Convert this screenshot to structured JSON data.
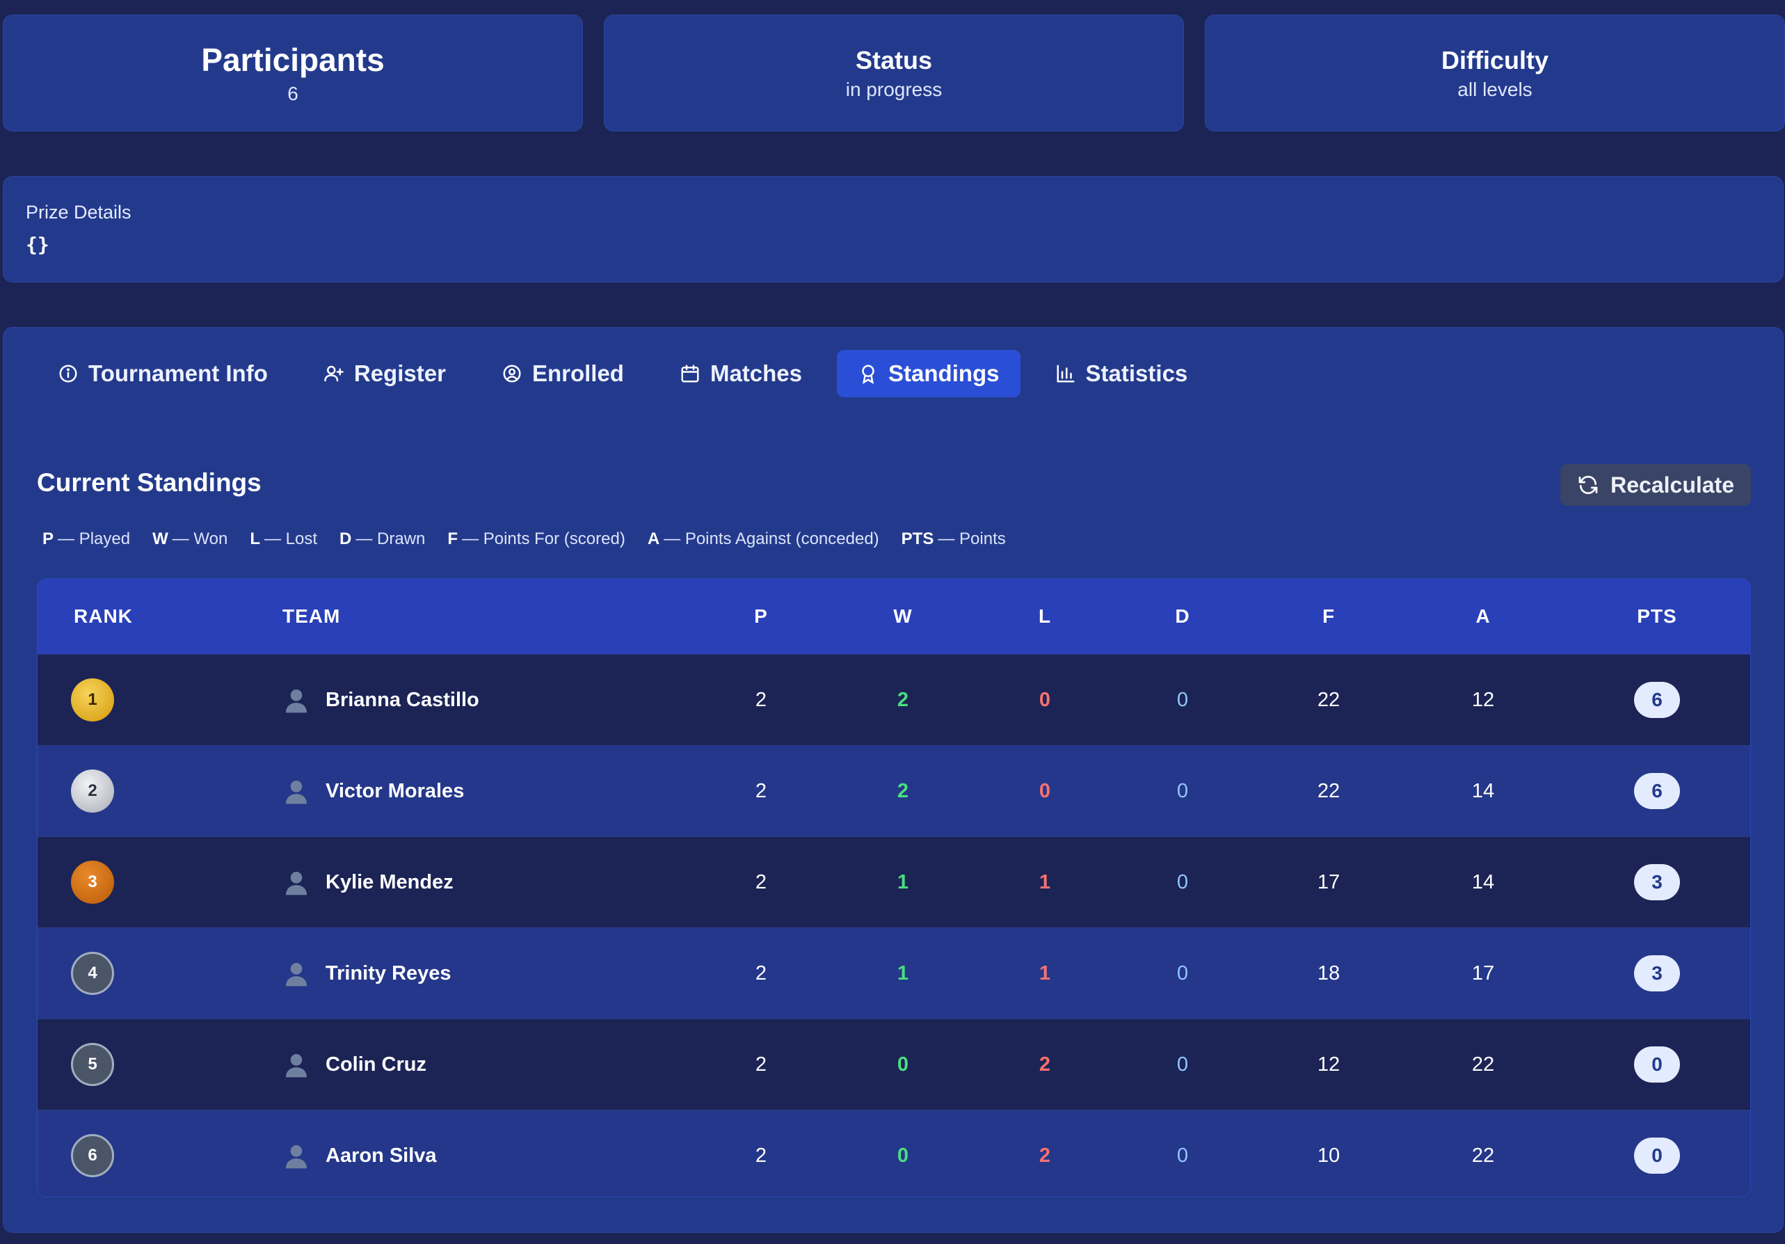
{
  "stats": {
    "participants": {
      "label": "Participants",
      "value": "6"
    },
    "status": {
      "label": "Status",
      "value": "in progress"
    },
    "difficulty": {
      "label": "Difficulty",
      "value": "all levels"
    }
  },
  "prize": {
    "label": "Prize Details",
    "value": "{}"
  },
  "tabs": [
    {
      "label": "Tournament Info",
      "icon": "info-icon"
    },
    {
      "label": "Register",
      "icon": "user-plus-icon"
    },
    {
      "label": "Enrolled",
      "icon": "user-circle-icon"
    },
    {
      "label": "Matches",
      "icon": "calendar-icon"
    },
    {
      "label": "Standings",
      "icon": "award-icon",
      "active": true
    },
    {
      "label": "Statistics",
      "icon": "bar-chart-icon"
    }
  ],
  "standings": {
    "title": "Current Standings",
    "recalculate_label": "Recalculate",
    "legend": [
      {
        "key": "P",
        "text": "— Played"
      },
      {
        "key": "W",
        "text": "— Won"
      },
      {
        "key": "L",
        "text": "— Lost"
      },
      {
        "key": "D",
        "text": "— Drawn"
      },
      {
        "key": "F",
        "text": "— Points For (scored)"
      },
      {
        "key": "A",
        "text": "— Points Against (conceded)"
      },
      {
        "key": "PTS",
        "text": "— Points"
      }
    ],
    "columns": {
      "rank": "RANK",
      "team": "TEAM",
      "p": "P",
      "w": "W",
      "l": "L",
      "d": "D",
      "f": "F",
      "a": "A",
      "pts": "PTS"
    },
    "rows": [
      {
        "rank": "1",
        "team": "Brianna Castillo",
        "p": "2",
        "w": "2",
        "l": "0",
        "d": "0",
        "f": "22",
        "a": "12",
        "pts": "6"
      },
      {
        "rank": "2",
        "team": "Victor Morales",
        "p": "2",
        "w": "2",
        "l": "0",
        "d": "0",
        "f": "22",
        "a": "14",
        "pts": "6"
      },
      {
        "rank": "3",
        "team": "Kylie Mendez",
        "p": "2",
        "w": "1",
        "l": "1",
        "d": "0",
        "f": "17",
        "a": "14",
        "pts": "3"
      },
      {
        "rank": "4",
        "team": "Trinity Reyes",
        "p": "2",
        "w": "1",
        "l": "1",
        "d": "0",
        "f": "18",
        "a": "17",
        "pts": "3"
      },
      {
        "rank": "5",
        "team": "Colin Cruz",
        "p": "2",
        "w": "0",
        "l": "2",
        "d": "0",
        "f": "12",
        "a": "22",
        "pts": "0"
      },
      {
        "rank": "6",
        "team": "Aaron Silva",
        "p": "2",
        "w": "0",
        "l": "2",
        "d": "0",
        "f": "10",
        "a": "22",
        "pts": "0"
      }
    ]
  },
  "colors": {
    "background": "#1b2454",
    "card": "#233a8c",
    "accent": "#2a4fd6",
    "win": "#4ade80",
    "loss": "#f87171"
  }
}
